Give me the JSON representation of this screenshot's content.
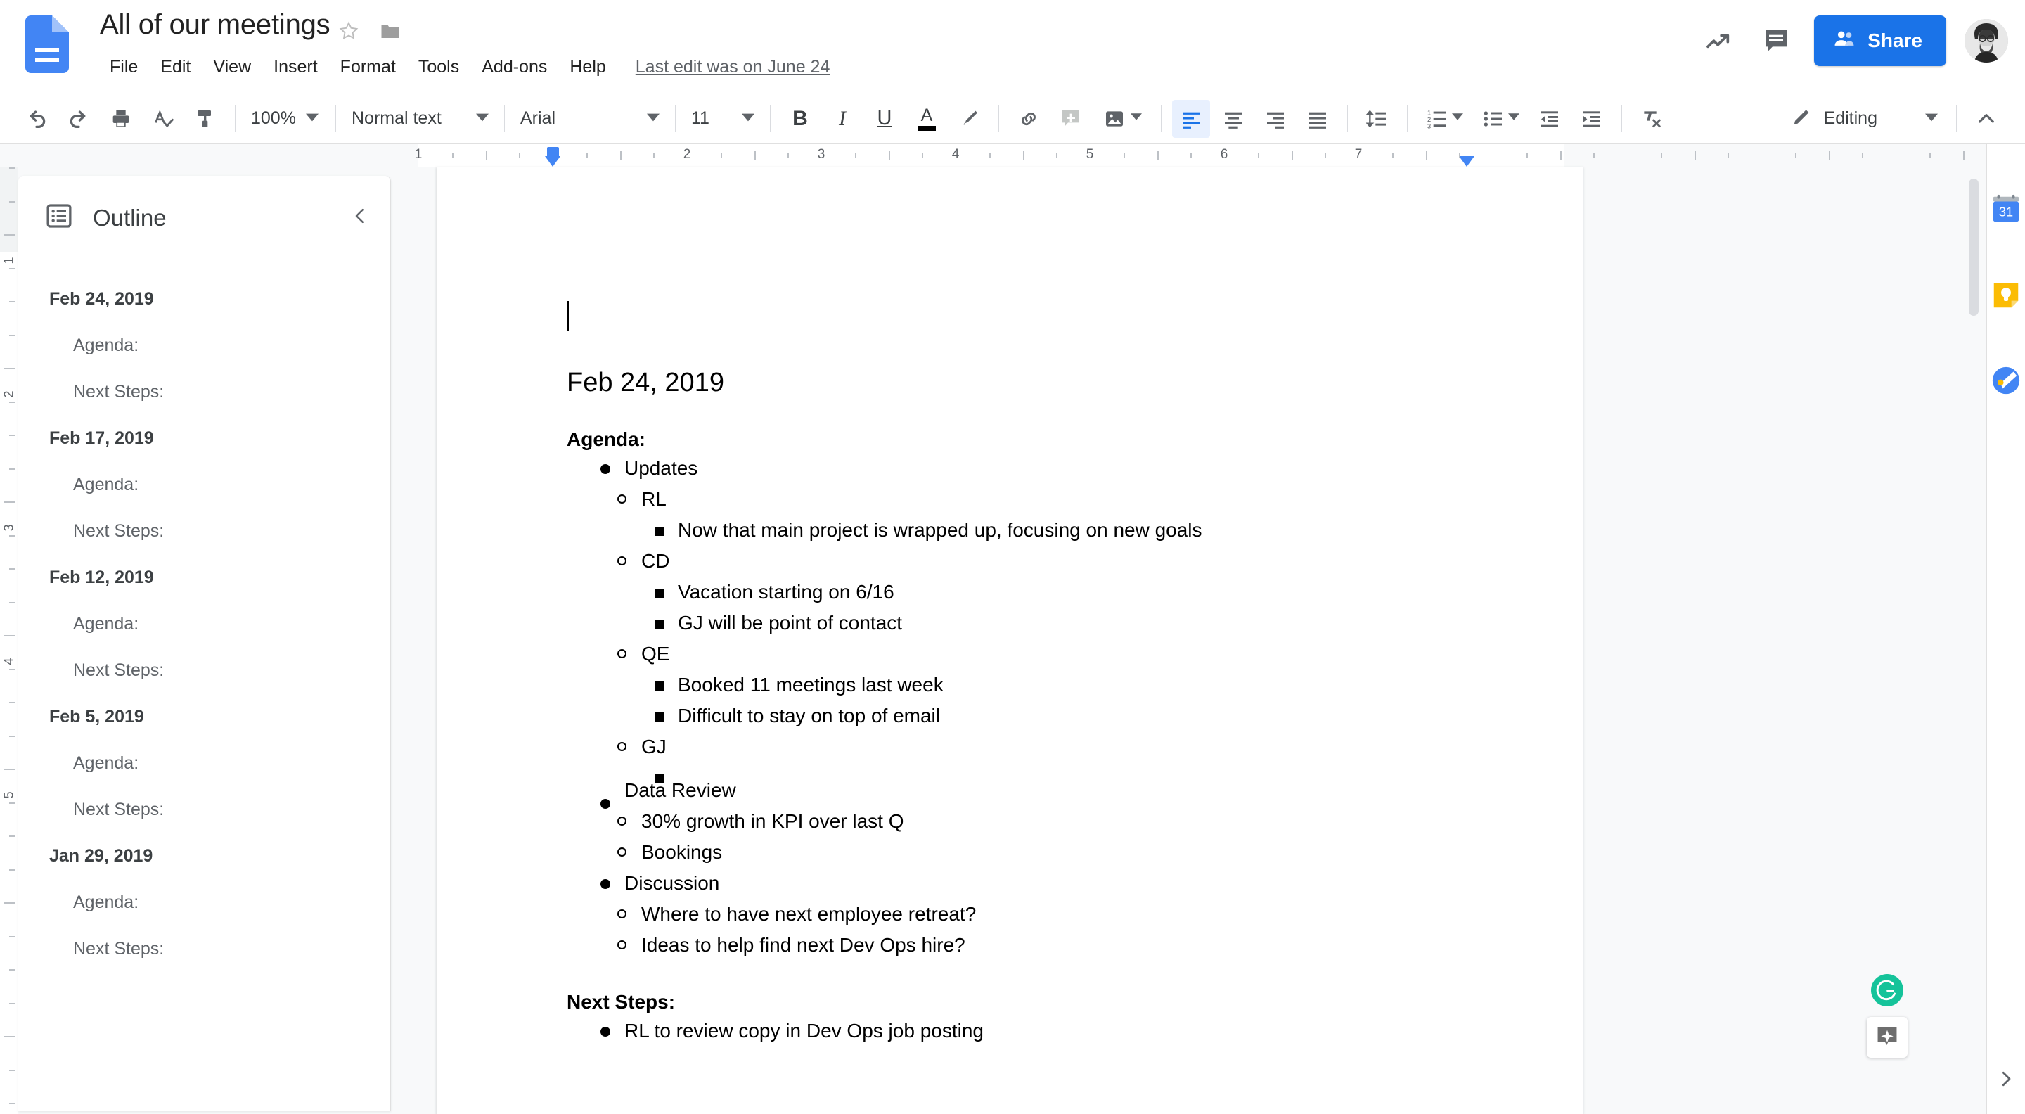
{
  "header": {
    "doc_title": "All of our meetings",
    "star_icon": "star-outline-icon",
    "folder_icon": "folder-icon",
    "menu_items": [
      "File",
      "Edit",
      "View",
      "Insert",
      "Format",
      "Tools",
      "Add-ons",
      "Help"
    ],
    "last_edit": "Last edit was on June 24",
    "activity_icon": "trending-up-icon",
    "comments_icon": "comment-icon",
    "share_label": "Share",
    "share_icon": "person-add-icon",
    "avatar_name": "account-avatar",
    "brand_blue": "#1a73e8"
  },
  "toolbar": {
    "undo": "undo-icon",
    "redo": "redo-icon",
    "print": "print-icon",
    "spellcheck": "spellcheck-icon",
    "paint_format": "paint-format-icon",
    "zoom_value": "100%",
    "style_value": "Normal text",
    "font_value": "Arial",
    "size_value": "11",
    "bold": "B",
    "italic": "I",
    "underline": "U",
    "text_color": "A",
    "highlight": "highlight-pen-icon",
    "insert_link": "link-icon",
    "add_comment": "add-comment-icon",
    "insert_image": "image-icon",
    "align_left": "align-left-icon",
    "align_center": "align-center-icon",
    "align_right": "align-right-icon",
    "align_justify": "align-justify-icon",
    "line_spacing": "line-spacing-icon",
    "numbered_list": "numbered-list-icon",
    "bulleted_list": "bulleted-list-icon",
    "decrease_indent": "decrease-indent-icon",
    "increase_indent": "increase-indent-icon",
    "clear_format": "clear-formatting-icon",
    "mode_label": "Editing",
    "mode_icon": "pencil-icon",
    "collapse_icon": "chevron-up-icon"
  },
  "ruler": {
    "h_numbers": [
      "1",
      "2",
      "3",
      "4",
      "5",
      "6",
      "7"
    ],
    "v_numbers": [
      "1",
      "2",
      "3",
      "4",
      "5"
    ]
  },
  "outline": {
    "title": "Outline",
    "icon": "outline-list-icon",
    "collapse_icon": "chevron-left-icon",
    "items": [
      {
        "label": "Feb 24, 2019",
        "level": 1
      },
      {
        "label": "Agenda:",
        "level": 2
      },
      {
        "label": "Next Steps:",
        "level": 2
      },
      {
        "label": "Feb 17, 2019",
        "level": 1
      },
      {
        "label": "Agenda:",
        "level": 2
      },
      {
        "label": "Next Steps:",
        "level": 2
      },
      {
        "label": "Feb 12, 2019",
        "level": 1
      },
      {
        "label": "Agenda:",
        "level": 2
      },
      {
        "label": "Next Steps:",
        "level": 2
      },
      {
        "label": "Feb 5, 2019",
        "level": 1
      },
      {
        "label": "Agenda:",
        "level": 2
      },
      {
        "label": "Next Steps:",
        "level": 2
      },
      {
        "label": "Jan 29, 2019",
        "level": 1
      },
      {
        "label": "Agenda:",
        "level": 2
      },
      {
        "label": "Next Steps:",
        "level": 2
      }
    ]
  },
  "document": {
    "heading": "Feb 24, 2019",
    "agenda_label": "Agenda:",
    "next_steps_label": "Next Steps:",
    "agenda": {
      "updates": "Updates",
      "rl": "RL",
      "rl_note": "Now that main project is wrapped up, focusing on new goals",
      "cd": "CD",
      "cd_note_1": "Vacation starting on 6/16",
      "cd_note_2": "GJ will be point of contact",
      "qe": "QE",
      "qe_note_1": "Booked 11 meetings last week",
      "qe_note_2": "Difficult to stay on top of email",
      "gj": "GJ",
      "gj_note_1": "",
      "data_review": "Data Review",
      "data_note_1": "30% growth in KPI over last Q",
      "data_note_2": "Bookings",
      "discussion": "Discussion",
      "discussion_note_1": "Where to have next employee retreat?",
      "discussion_note_2": "Ideas to help find next Dev Ops hire?"
    },
    "next_steps": {
      "item_1": "RL to review copy in Dev Ops job posting"
    }
  },
  "right_sidebar": {
    "calendar_icon": "google-calendar-icon",
    "calendar_day": "31",
    "keep_icon": "google-keep-icon",
    "tasks_icon": "google-tasks-icon",
    "expand_icon": "chevron-right-icon"
  },
  "floating": {
    "grammarly_icon": "grammarly-badge-icon",
    "explore_icon": "explore-sparkle-icon"
  }
}
